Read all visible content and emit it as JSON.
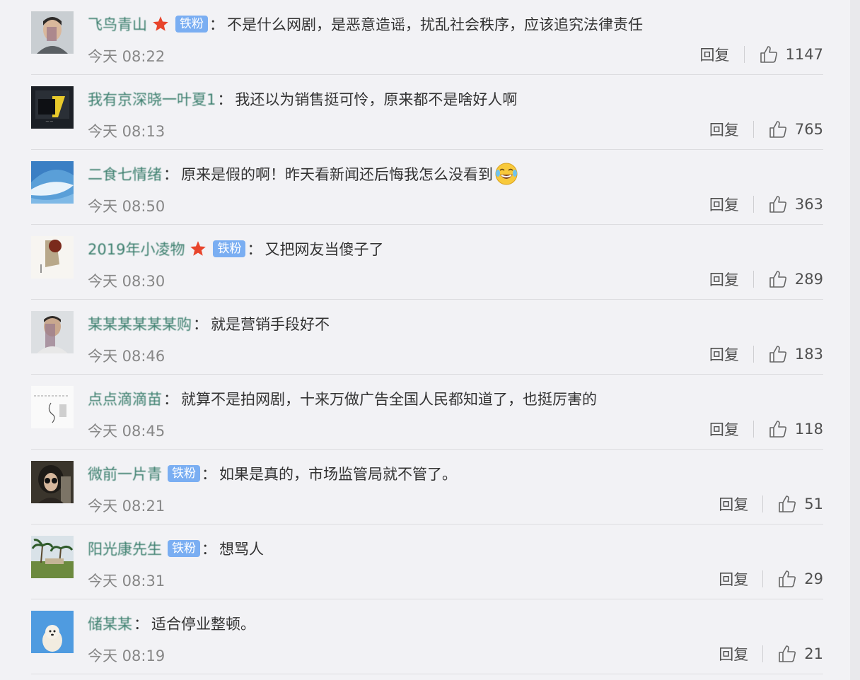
{
  "comments": [
    {
      "username": "飞鸟青山",
      "verified_star": true,
      "badge": "铁粉",
      "content": "不是什么网剧，是恶意造谣，扰乱社会秩序，应该追究法律责任",
      "time": "今天 08:22",
      "reply_label": "回复",
      "likes": "1147",
      "avatar": "young-man-photo"
    },
    {
      "username": "我有京深晓一叶夏1",
      "verified_star": false,
      "badge": "",
      "content": "我还以为销售挺可怜，原来都不是啥好人啊",
      "time": "今天 08:13",
      "reply_label": "回复",
      "likes": "765",
      "avatar": "dark-shirt-photo"
    },
    {
      "username": "二食七情绪",
      "verified_star": false,
      "badge": "",
      "content": "原来是假的啊！昨天看新闻还后悔我怎么没看到",
      "emoji": "laugh-cry-emoji",
      "time": "今天 08:50",
      "reply_label": "回复",
      "likes": "363",
      "avatar": "blue-wave-image"
    },
    {
      "username": "2019年小凌物",
      "verified_star": true,
      "badge": "铁粉",
      "content": "又把网友当傻子了",
      "time": "今天 08:30",
      "reply_label": "回复",
      "likes": "289",
      "avatar": "sketch-portrait"
    },
    {
      "username": "某某某某某某购",
      "verified_star": false,
      "badge": "",
      "content": "就是营销手段好不",
      "time": "今天 08:46",
      "reply_label": "回复",
      "likes": "183",
      "avatar": "person-photo"
    },
    {
      "username": "点点滴滴苗",
      "verified_star": false,
      "badge": "",
      "content": "就算不是拍网剧，十来万做广告全国人民都知道了，也挺厉害的",
      "time": "今天 08:45",
      "reply_label": "回复",
      "likes": "118",
      "avatar": "sketch-drawing"
    },
    {
      "username": "微前一片青",
      "verified_star": false,
      "badge": "铁粉",
      "content": "如果是真的，市场监管局就不管了。",
      "time": "今天 08:21",
      "reply_label": "回复",
      "likes": "51",
      "avatar": "sunglasses-man"
    },
    {
      "username": "阳光康先生",
      "verified_star": false,
      "badge": "铁粉",
      "content": "想骂人",
      "time": "今天 08:31",
      "reply_label": "回复",
      "likes": "29",
      "avatar": "palm-trees"
    },
    {
      "username": "储某某",
      "verified_star": false,
      "badge": "",
      "content": "适合停业整顿。",
      "time": "今天 08:19",
      "reply_label": "回复",
      "likes": "21",
      "avatar": "white-dog"
    }
  ],
  "colors": {
    "background": "#f2f2f5",
    "username": "#3c7f6e",
    "badge": "#7aaef2",
    "star": "#e8452c",
    "time": "#878787",
    "text": "#333333"
  }
}
